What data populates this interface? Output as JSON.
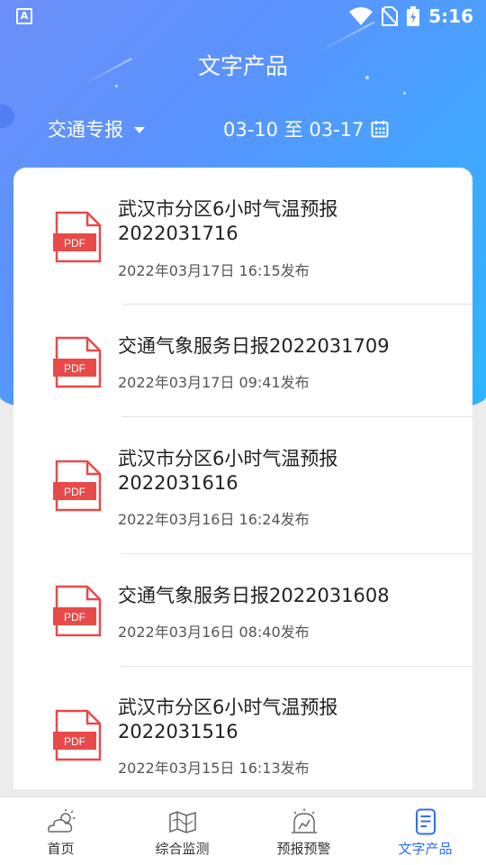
{
  "status_bar": {
    "left_icon_letter": "A",
    "time": "5:16"
  },
  "header": {
    "title": "文字产品"
  },
  "filter": {
    "type_label": "交通专报",
    "date_range": "03-10 至 03-17"
  },
  "items": [
    {
      "title_line1": "武汉市分区6小时气温预报",
      "title_line2": "2022031716",
      "published": "2022年03月17日 16:15发布",
      "badge": "PDF"
    },
    {
      "title_line1": "交通气象服务日报2022031709",
      "title_line2": "",
      "published": "2022年03月17日 09:41发布",
      "badge": "PDF"
    },
    {
      "title_line1": "武汉市分区6小时气温预报",
      "title_line2": "2022031616",
      "published": "2022年03月16日 16:24发布",
      "badge": "PDF"
    },
    {
      "title_line1": "交通气象服务日报2022031608",
      "title_line2": "",
      "published": "2022年03月16日 08:40发布",
      "badge": "PDF"
    },
    {
      "title_line1": "武汉市分区6小时气温预报",
      "title_line2": "2022031516",
      "published": "2022年03月15日 16:13发布",
      "badge": "PDF"
    }
  ],
  "tabs": [
    {
      "label": "首页",
      "icon": "weather-icon"
    },
    {
      "label": "综合监测",
      "icon": "map-icon"
    },
    {
      "label": "预报预警",
      "icon": "alert-icon"
    },
    {
      "label": "文字产品",
      "icon": "document-icon"
    }
  ],
  "colors": {
    "accent": "#2f6df6",
    "pdf_red": "#e84a4a",
    "header_start": "#6d8ff7",
    "header_end": "#2bb6ff"
  }
}
